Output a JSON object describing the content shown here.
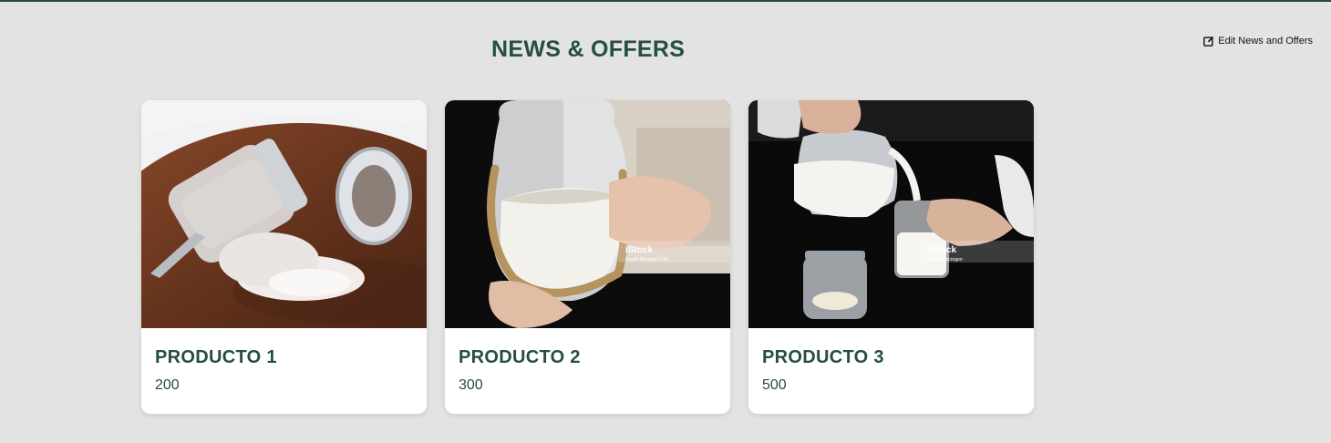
{
  "section": {
    "title": "NEWS & OFFERS",
    "edit_label": "Edit News and Offers"
  },
  "colors": {
    "accent": "#264f40",
    "background": "#e3e3e3",
    "card": "#ffffff"
  },
  "products": [
    {
      "name": "PRODUCTO 1",
      "price": "200",
      "image": "flour-jar-photo"
    },
    {
      "name": "PRODUCTO 2",
      "price": "300",
      "image": "jar-held-in-hands-photo",
      "watermark": {
        "brand": "iStock",
        "credit": "Credit: Bustanul Cebi"
      }
    },
    {
      "name": "PRODUCTO 3",
      "price": "500",
      "image": "milk-pouring-photo",
      "watermark": {
        "brand": "iStock",
        "credit": "Credit: microgen"
      }
    }
  ]
}
